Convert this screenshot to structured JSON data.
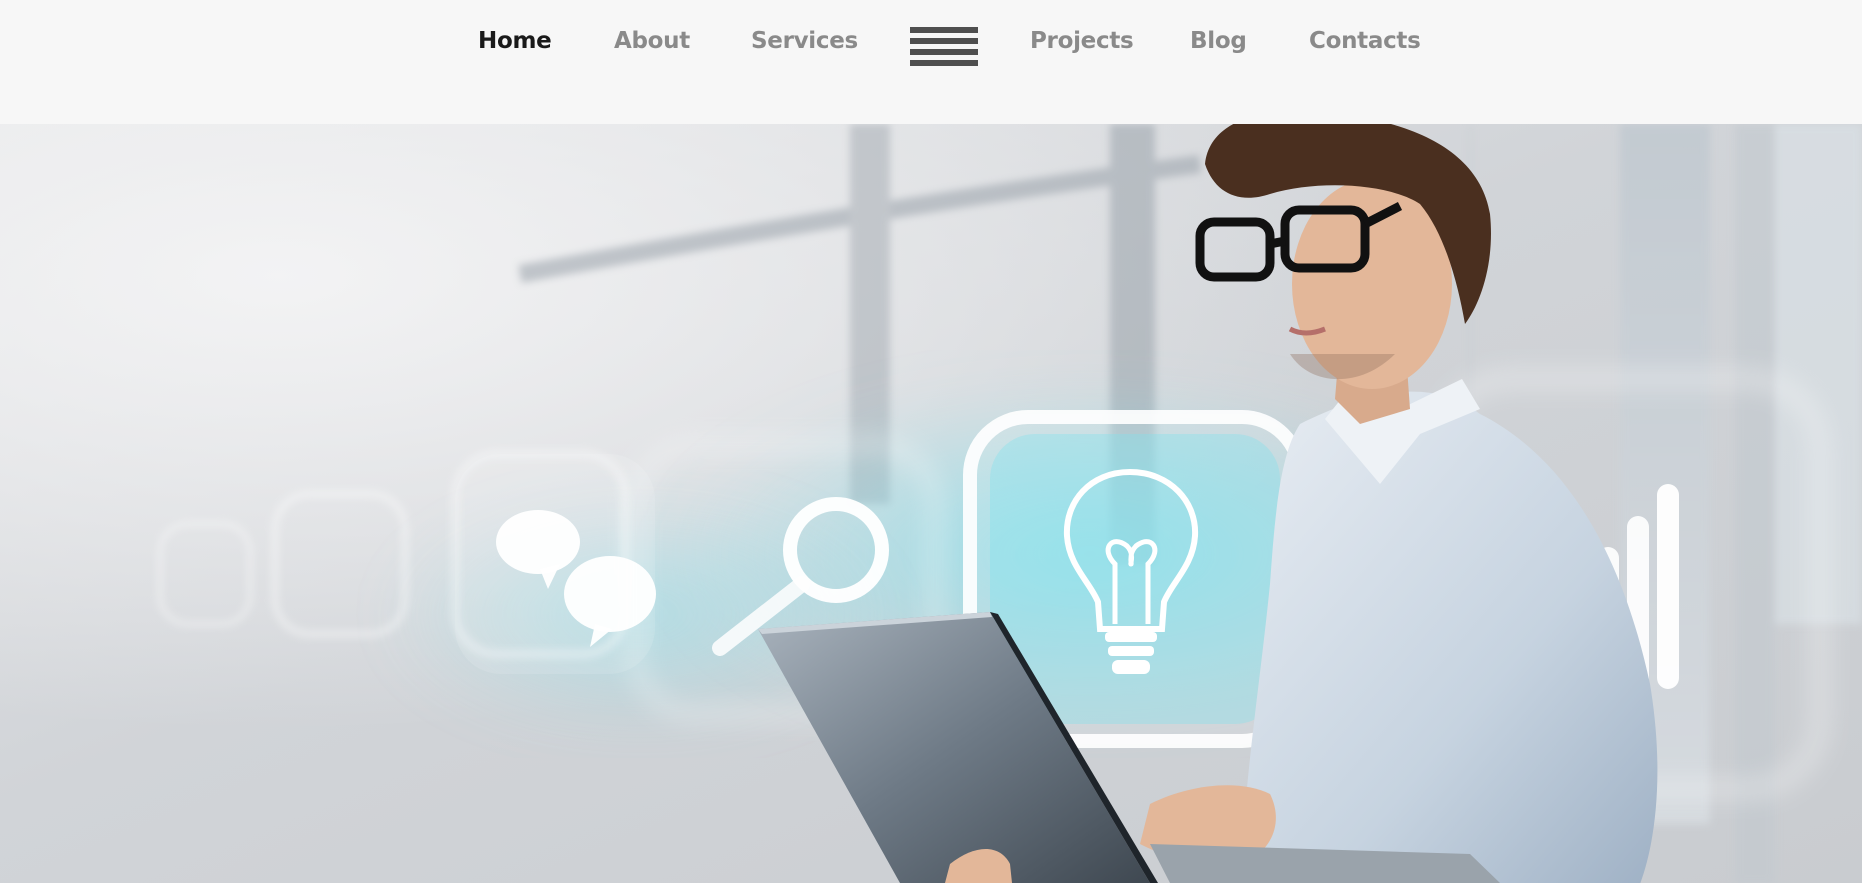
{
  "nav": {
    "items": [
      {
        "id": "home",
        "label": "Home",
        "active": true
      },
      {
        "id": "about",
        "label": "About",
        "active": false
      },
      {
        "id": "services",
        "label": "Services",
        "active": false
      },
      {
        "id": "projects",
        "label": "Projects",
        "active": false
      },
      {
        "id": "blog",
        "label": "Blog",
        "active": false
      },
      {
        "id": "contacts",
        "label": "Contacts",
        "active": false
      }
    ],
    "menu_icon": "hamburger-menu-icon"
  },
  "hero": {
    "image": "man-with-laptop-and-glowing-icons",
    "icons": [
      "chat-bubbles-icon",
      "search-icon",
      "lightbulb-icon",
      "bar-chart-icon"
    ]
  },
  "colors": {
    "nav_text": "#8a8a8a",
    "nav_active": "#1a1a1a",
    "header_bg": "#f7f7f7",
    "glow": "#7fe3ef"
  }
}
